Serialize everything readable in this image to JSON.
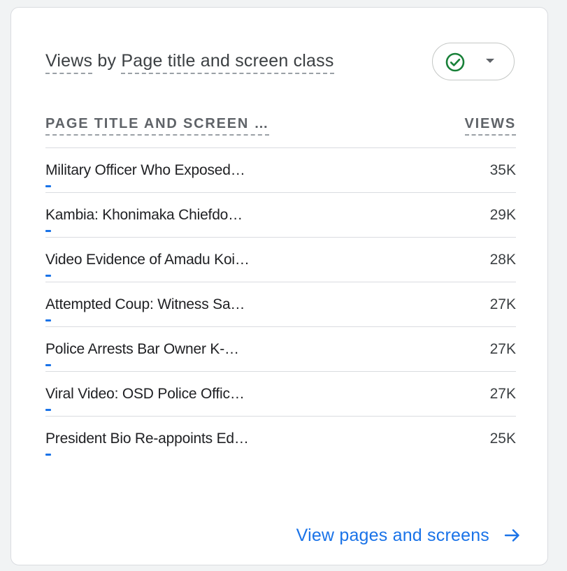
{
  "card": {
    "title_metric": "Views",
    "title_by": "by",
    "title_dimension": "Page title and screen class",
    "status_icon": "check-circle-icon",
    "status_color": "#188038"
  },
  "table": {
    "columns": {
      "title": "PAGE TITLE AND SCREEN …",
      "views": "VIEWS"
    },
    "rows": [
      {
        "title": "Military Officer Who Exposed…",
        "views": "35K",
        "share": 0.02
      },
      {
        "title": "Kambia: Khonimaka Chiefdo…",
        "views": "29K",
        "share": 0.02
      },
      {
        "title": "Video Evidence of Amadu Koi…",
        "views": "28K",
        "share": 0.02
      },
      {
        "title": "Attempted Coup: Witness Sa…",
        "views": "27K",
        "share": 0.02
      },
      {
        "title": "Police Arrests Bar Owner K-…",
        "views": "27K",
        "share": 0.02
      },
      {
        "title": "Viral Video: OSD Police Offic…",
        "views": "27K",
        "share": 0.02
      },
      {
        "title": "President Bio Re-appoints Ed…",
        "views": "25K",
        "share": 0.02
      }
    ]
  },
  "footer": {
    "link_label": "View pages and screens",
    "link_icon": "arrow-right-icon"
  },
  "colors": {
    "accent": "#1a73e8",
    "success": "#188038"
  }
}
